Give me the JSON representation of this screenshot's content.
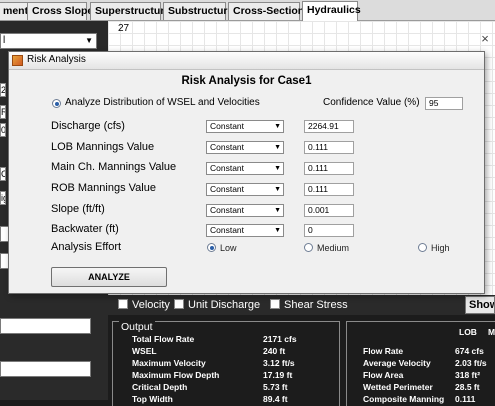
{
  "tabs": [
    "ment",
    "Cross Slope",
    "Superstructure",
    "Substructure",
    "Cross-Sections",
    "Hydraulics"
  ],
  "left_panel": {
    "dropdown_value": "l",
    "stubs": [
      "20",
      "Ra",
      "0",
      "C",
      "ig"
    ]
  },
  "canvas": {
    "number": "27"
  },
  "dialog": {
    "title": "Risk Analysis",
    "heading": "Risk Analysis for Case1",
    "analyze_option": "Analyze Distribution of WSEL and Velocities",
    "confidence_label": "Confidence Value (%)",
    "confidence_value": "95",
    "rows": [
      {
        "label": "Discharge (cfs)",
        "dist": "Constant",
        "value": "2264.91"
      },
      {
        "label": "LOB Mannings Value",
        "dist": "Constant",
        "value": "0.111"
      },
      {
        "label": "Main Ch. Mannings Value",
        "dist": "Constant",
        "value": "0.111"
      },
      {
        "label": "ROB Mannings Value",
        "dist": "Constant",
        "value": "0.111"
      },
      {
        "label": "Slope (ft/ft)",
        "dist": "Constant",
        "value": "0.001"
      },
      {
        "label": "Backwater (ft)",
        "dist": "Constant",
        "value": "0"
      }
    ],
    "effort_label": "Analysis Effort",
    "effort_options": [
      "Low",
      "Medium",
      "High"
    ],
    "analyze_button": "ANALYZE"
  },
  "checks": [
    "Velocity",
    "Unit Discharge",
    "Shear Stress"
  ],
  "show_button": "Show L",
  "output": {
    "legend": "Output",
    "left_rows": [
      {
        "label": "Total Flow Rate",
        "value": "2171 cfs"
      },
      {
        "label": "WSEL",
        "value": "240 ft"
      },
      {
        "label": "Maximum Velocity",
        "value": "3.12 ft/s"
      },
      {
        "label": "Maximum Flow Depth",
        "value": "17.19 ft"
      },
      {
        "label": "Critical Depth",
        "value": "5.73 ft"
      },
      {
        "label": "Top Width",
        "value": "89.4 ft"
      }
    ],
    "right_header": [
      "LOB",
      "M"
    ],
    "right_rows": [
      {
        "label": "Flow Rate",
        "value": "674 cfs"
      },
      {
        "label": "Average Velocity",
        "value": "2.03 ft/s"
      },
      {
        "label": "Flow Area",
        "value": "318 ft²"
      },
      {
        "label": "Wetted Perimeter",
        "value": "28.5 ft"
      },
      {
        "label": "Composite Manning",
        "value": "0.111"
      }
    ]
  }
}
